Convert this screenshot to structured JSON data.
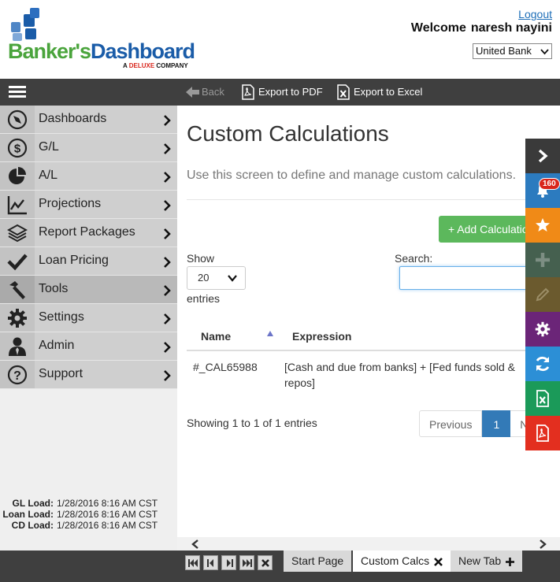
{
  "header": {
    "logo_text": "Banker's Dashboard",
    "logo_tagline": "A DELUXE COMPANY",
    "logout_label": "Logout",
    "welcome_label": "Welcome",
    "user_name": "naresh nayini",
    "bank_selected": "United Bank"
  },
  "toolbar": {
    "back_label": "Back",
    "export_pdf_label": "Export to PDF",
    "export_excel_label": "Export to Excel"
  },
  "sidebar": {
    "items": [
      {
        "label": "Dashboards",
        "icon": "compass-icon"
      },
      {
        "label": "G/L",
        "icon": "dollar-icon"
      },
      {
        "label": "A/L",
        "icon": "pie-chart-icon"
      },
      {
        "label": "Projections",
        "icon": "line-chart-icon"
      },
      {
        "label": "Report Packages",
        "icon": "layers-icon"
      },
      {
        "label": "Loan Pricing",
        "icon": "checkmark-icon"
      },
      {
        "label": "Tools",
        "icon": "hammer-icon"
      },
      {
        "label": "Settings",
        "icon": "gear-icon"
      },
      {
        "label": "Admin",
        "icon": "person-icon"
      },
      {
        "label": "Support",
        "icon": "question-icon"
      }
    ],
    "loads": [
      {
        "label": "GL Load:",
        "value": "1/28/2016 8:16 AM CST"
      },
      {
        "label": "Loan Load:",
        "value": "1/28/2016 8:16 AM CST"
      },
      {
        "label": "CD Load:",
        "value": "1/28/2016 8:16 AM CST"
      }
    ]
  },
  "main": {
    "title": "Custom Calculations",
    "description": "Use this screen to define and manage custom calculations.",
    "add_button_label": "+ Add Calculation",
    "show_label": "Show",
    "page_length": "20",
    "entries_label": "entries",
    "search_label": "Search:",
    "search_value": "",
    "columns": [
      "Name",
      "Expression"
    ],
    "rows": [
      {
        "name": "#_CAL65988",
        "expression": "[Cash and due from banks] + [Fed funds sold & repos]"
      }
    ],
    "info": "Showing 1 to 1 of 1 entries",
    "pager": {
      "previous": "Previous",
      "current": "1",
      "next": "Next"
    }
  },
  "tabs": [
    {
      "label": "Start Page"
    },
    {
      "label": "Custom Calcs"
    },
    {
      "label": "New Tab"
    }
  ],
  "rightbar": {
    "notification_count": "160",
    "colors": {
      "toggle": "#3a3a3a",
      "notifications": "#2c7bbf",
      "favorites": "#f08a17",
      "add": "#45604f",
      "edit": "#6b5a2e",
      "settings": "#6b2578",
      "refresh": "#2c8fd6",
      "excel": "#1b9a59",
      "pdf": "#e32f1f"
    }
  },
  "colors": {
    "logo_blue": "#1a5ca8",
    "logo_green": "#4aa43c",
    "add_button": "#5cb85c",
    "pager_active": "#337ab7"
  }
}
